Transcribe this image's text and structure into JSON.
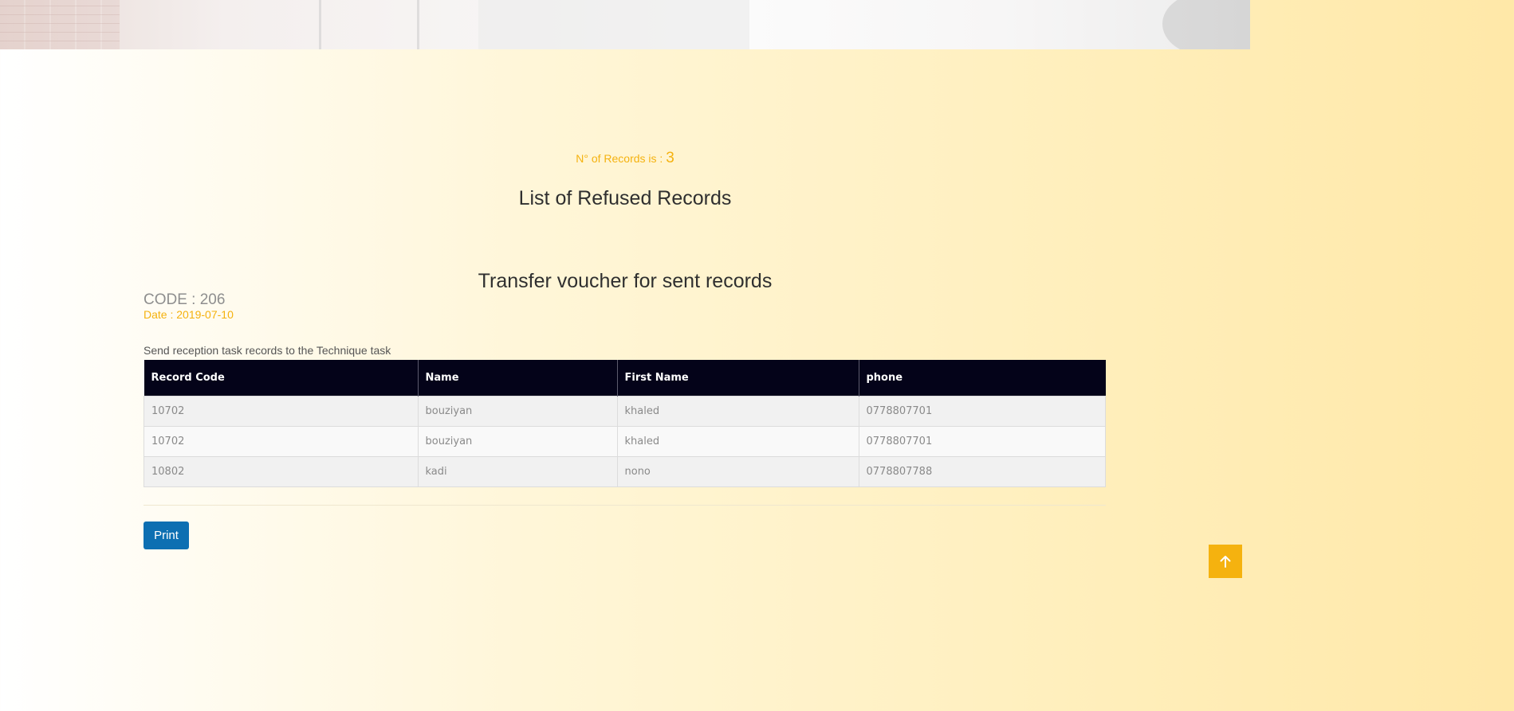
{
  "summary": {
    "count_label": "N° of Records is : ",
    "count_value": "3"
  },
  "page_title": "List of Refused Records",
  "voucher": {
    "title": "Transfer voucher for sent records",
    "code_label": "CODE : 206",
    "date_label": "Date : 2019-07-10",
    "description": "Send reception task records to the Technique task"
  },
  "table": {
    "columns": [
      "Record Code",
      "Name",
      "First Name",
      "phone"
    ],
    "rows": [
      [
        "10702",
        "bouziyan",
        "khaled",
        "0778807701"
      ],
      [
        "10702",
        "bouziyan",
        "khaled",
        "0778807701"
      ],
      [
        "10802",
        "kadi",
        "nono",
        "0778807788"
      ]
    ]
  },
  "actions": {
    "print_label": "Print",
    "scroll_top_icon": "arrow-up-icon"
  },
  "colors": {
    "accent": "#f5b20f",
    "table_header": "#040319",
    "print_button": "#0d6fb2"
  }
}
